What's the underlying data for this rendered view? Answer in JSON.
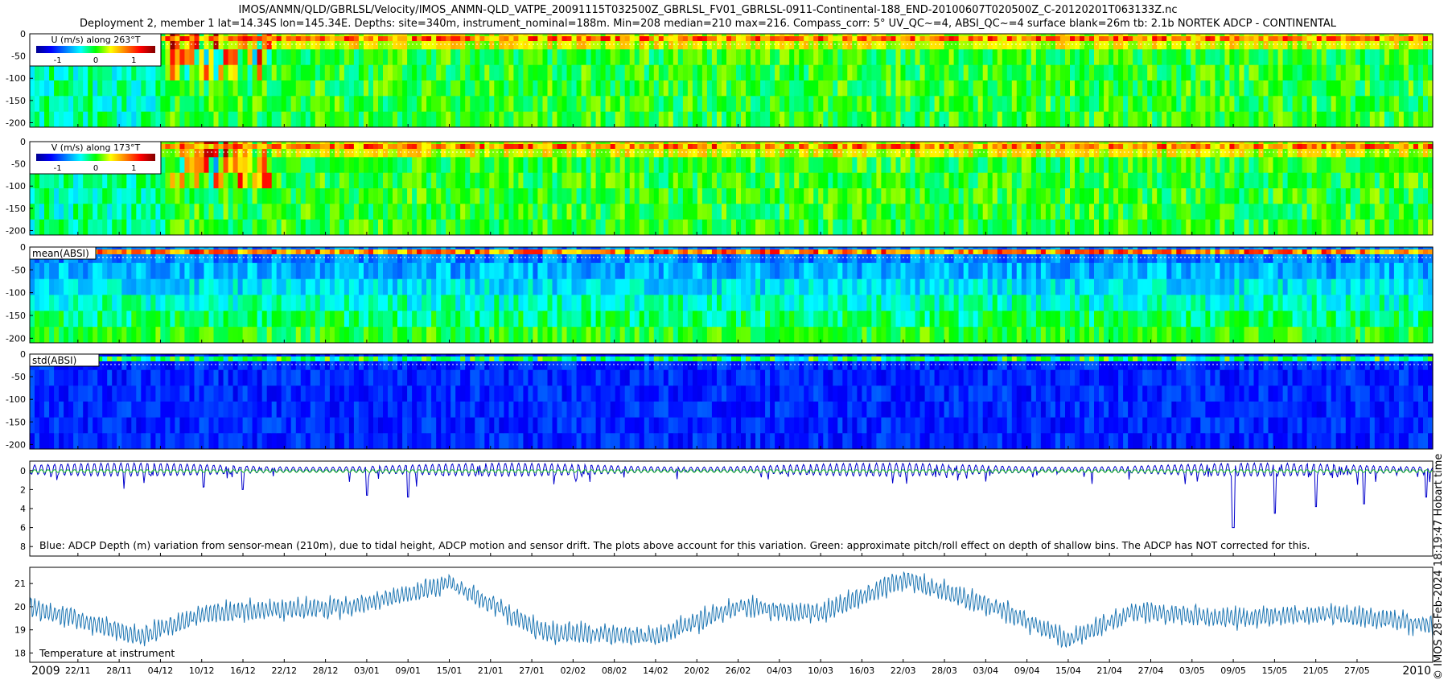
{
  "title_line1": "IMOS/ANMN/QLD/GBRLSL/Velocity/IMOS_ANMN-QLD_VATPE_20091115T032500Z_GBRLSL_FV01_GBRLSL-0911-Continental-188_END-20100607T020500Z_C-20120201T063133Z.nc",
  "title_line2": "Deployment 2, member 1 lat=14.34S lon=145.34E. Depths: site=340m, instrument_nominal=188m. Min=208 median=210 max=216. Compass_corr: 5° UV_QC~=4, ABSI_QC~=4 surface blank=26m tb: 2.1b NORTEK ADCP - CONTINENTAL",
  "side_note": "© IMOS 28-Feb-2024 18:19:47 Hobart time",
  "colors": {
    "blue": "#0000cc",
    "green": "#22cc22",
    "line": "#1f77b4"
  },
  "chart_data": [
    {
      "type": "heatmap",
      "legend_title": "U (m/s) along 263°T",
      "colorbar_ticks": [
        "-1",
        "0",
        "1"
      ],
      "yticks": [
        "0",
        "-50",
        "-100",
        "-150",
        "-200"
      ],
      "ylim": [
        -210,
        0
      ],
      "dominant_value": 0
    },
    {
      "type": "heatmap",
      "legend_title": "V (m/s) along 173°T",
      "colorbar_ticks": [
        "-1",
        "0",
        "1"
      ],
      "yticks": [
        "0",
        "-50",
        "-100",
        "-150",
        "-200"
      ],
      "ylim": [
        -210,
        0
      ],
      "dominant_value": 0
    },
    {
      "type": "heatmap",
      "legend_title": "mean(ABSI)",
      "yticks": [
        "0",
        "-50",
        "-100",
        "-150",
        "-200"
      ],
      "ylim": [
        -210,
        0
      ]
    },
    {
      "type": "heatmap",
      "legend_title": "std(ABSI)",
      "yticks": [
        "0",
        "-50",
        "-100",
        "-150",
        "-200"
      ],
      "ylim": [
        -210,
        0
      ]
    },
    {
      "type": "line",
      "yticks": [
        "0",
        "2",
        "4",
        "6",
        "8"
      ],
      "ylim": [
        -1,
        9
      ],
      "caption": "Blue: ADCP Depth (m) variation from sensor-mean (210m), due to tidal height, ADCP motion and sensor drift. The plots above account for this variation. Green: approximate pitch/roll effect on depth of shallow bins. The ADCP has NOT corrected for this.",
      "series": [
        {
          "color": "#0000cc",
          "tidal_amplitude": 0.7,
          "spikes": [
            [
              "2010-05-09",
              6.0
            ],
            [
              "2010-05-15",
              4.5
            ],
            [
              "2010-05-21",
              3.8
            ],
            [
              "2010-05-28",
              3.5
            ],
            [
              "2010-06-06",
              2.8
            ],
            [
              "2009-12-16",
              2.0
            ],
            [
              "2010-01-03",
              2.6
            ],
            [
              "2010-01-09",
              2.8
            ]
          ]
        },
        {
          "color": "#22cc22",
          "tidal_amplitude": 0.15
        }
      ]
    },
    {
      "type": "line",
      "label": "Temperature at instrument",
      "yticks": [
        "18",
        "19",
        "20",
        "21"
      ],
      "ylim": [
        17.6,
        21.7
      ],
      "color": "#1f77b4",
      "envelope": [
        [
          "2009-11-15",
          20.0
        ],
        [
          "2009-12-01",
          18.7
        ],
        [
          "2009-12-10",
          19.7
        ],
        [
          "2010-01-01",
          20.0
        ],
        [
          "2010-01-15",
          21.0
        ],
        [
          "2010-01-29",
          18.9
        ],
        [
          "2010-02-14",
          18.7
        ],
        [
          "2010-02-26",
          20.0
        ],
        [
          "2010-03-10",
          19.7
        ],
        [
          "2010-03-22",
          21.2
        ],
        [
          "2010-04-05",
          19.9
        ],
        [
          "2010-04-15",
          18.6
        ],
        [
          "2010-04-25",
          19.8
        ],
        [
          "2010-05-10",
          19.5
        ],
        [
          "2010-05-22",
          19.7
        ],
        [
          "2010-06-07",
          19.2
        ]
      ]
    }
  ],
  "x_axis": {
    "start": "2009-11-15",
    "end": "2010-06-07",
    "year_start_label": "2009",
    "year_end_label": "2010",
    "ticks": [
      {
        "date": "2009-11-22",
        "label": "22/11"
      },
      {
        "date": "2009-11-28",
        "label": "28/11"
      },
      {
        "date": "2009-12-04",
        "label": "04/12"
      },
      {
        "date": "2009-12-10",
        "label": "10/12"
      },
      {
        "date": "2009-12-16",
        "label": "16/12"
      },
      {
        "date": "2009-12-22",
        "label": "22/12"
      },
      {
        "date": "2009-12-28",
        "label": "28/12"
      },
      {
        "date": "2010-01-03",
        "label": "03/01"
      },
      {
        "date": "2010-01-09",
        "label": "09/01"
      },
      {
        "date": "2010-01-15",
        "label": "15/01"
      },
      {
        "date": "2010-01-21",
        "label": "21/01"
      },
      {
        "date": "2010-01-27",
        "label": "27/01"
      },
      {
        "date": "2010-02-02",
        "label": "02/02"
      },
      {
        "date": "2010-02-08",
        "label": "08/02"
      },
      {
        "date": "2010-02-14",
        "label": "14/02"
      },
      {
        "date": "2010-02-20",
        "label": "20/02"
      },
      {
        "date": "2010-02-26",
        "label": "26/02"
      },
      {
        "date": "2010-03-04",
        "label": "04/03"
      },
      {
        "date": "2010-03-10",
        "label": "10/03"
      },
      {
        "date": "2010-03-16",
        "label": "16/03"
      },
      {
        "date": "2010-03-22",
        "label": "22/03"
      },
      {
        "date": "2010-03-28",
        "label": "28/03"
      },
      {
        "date": "2010-04-03",
        "label": "03/04"
      },
      {
        "date": "2010-04-09",
        "label": "09/04"
      },
      {
        "date": "2010-04-15",
        "label": "15/04"
      },
      {
        "date": "2010-04-21",
        "label": "21/04"
      },
      {
        "date": "2010-04-27",
        "label": "27/04"
      },
      {
        "date": "2010-05-03",
        "label": "03/05"
      },
      {
        "date": "2010-05-09",
        "label": "09/05"
      },
      {
        "date": "2010-05-15",
        "label": "15/05"
      },
      {
        "date": "2010-05-21",
        "label": "21/05"
      },
      {
        "date": "2010-05-27",
        "label": "27/05"
      }
    ]
  }
}
